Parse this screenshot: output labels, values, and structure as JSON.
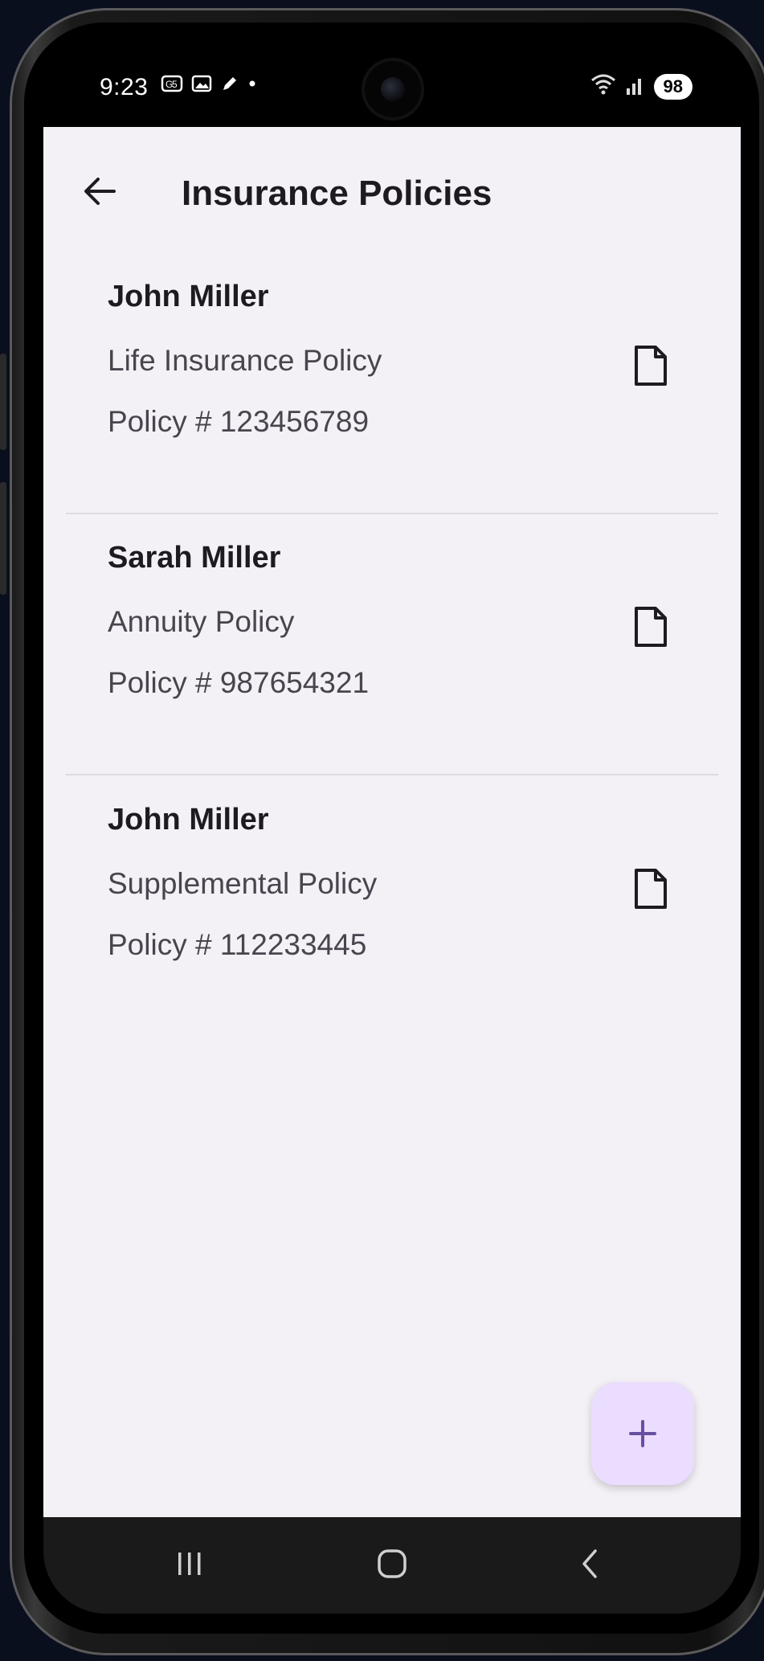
{
  "status_bar": {
    "time": "9:23",
    "battery": "98",
    "left_icons": [
      "notification-icon",
      "gallery-icon",
      "pen-icon",
      "dot-icon"
    ],
    "right_icons": [
      "wifi-icon",
      "signal-icon"
    ]
  },
  "header": {
    "title": "Insurance Policies",
    "back_icon": "arrow-left-icon"
  },
  "policies": [
    {
      "holder": "John Miller",
      "type": "Life Insurance Policy",
      "number": "Policy # 123456789"
    },
    {
      "holder": "Sarah Miller",
      "type": "Annuity Policy",
      "number": "Policy # 987654321"
    },
    {
      "holder": "John Miller",
      "type": "Supplemental Policy",
      "number": "Policy # 112233445"
    }
  ],
  "fab": {
    "icon": "plus-icon"
  },
  "nav": {
    "icons": [
      "recent-apps-icon",
      "home-icon",
      "back-icon"
    ]
  },
  "colors": {
    "background": "#f3f1f5",
    "fab_background": "#eaddff",
    "fab_icon": "#6750a4",
    "primary_text": "#1d1b20",
    "secondary_text": "#49454f"
  }
}
